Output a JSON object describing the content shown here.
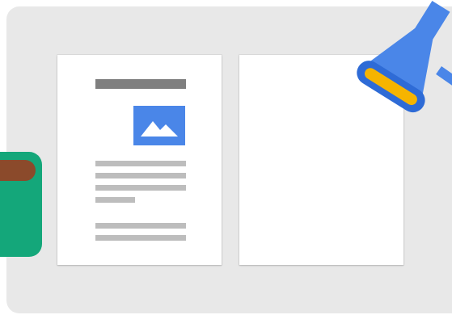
{
  "colors": {
    "board": "#e8e8e8",
    "page": "#ffffff",
    "title_bar": "#7f7f7f",
    "text_lines": "#bdbdbd",
    "image_tile": "#4a86e8",
    "mountain": "#ffffff",
    "green_device": "#14a77a",
    "brown_cap": "#8b4a2b",
    "lamp_body": "#4a86e8",
    "lamp_rim": "#2e6bd6",
    "lamp_light": "#f6b400"
  },
  "icons": {
    "image_placeholder": "image-icon",
    "lamp": "lamp-icon",
    "device": "device-icon"
  }
}
